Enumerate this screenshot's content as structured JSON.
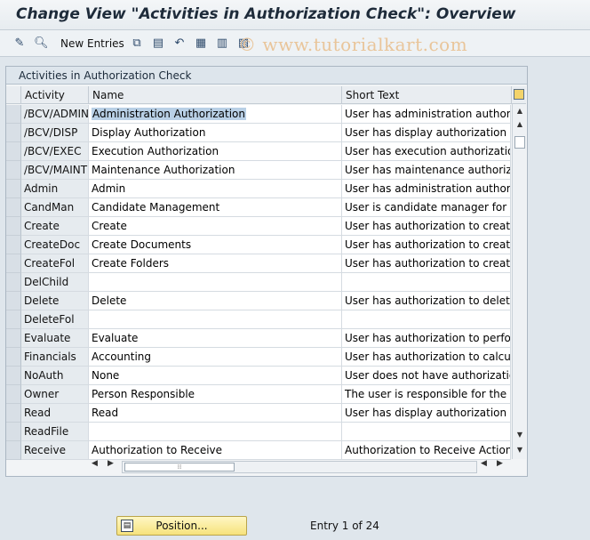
{
  "window": {
    "title": "Change View \"Activities in Authorization Check\": Overview"
  },
  "toolbar": {
    "new_entries_label": "New Entries",
    "watermark": "© www.tutorialkart.com",
    "icons": [
      "edit-toggle-icon",
      "details-icon",
      "copy-as-icon",
      "delete-icon",
      "undo-change-icon",
      "select-all-icon",
      "select-block-icon",
      "deselect-all-icon"
    ]
  },
  "panel": {
    "title": "Activities in Authorization Check",
    "columns": [
      "Activity",
      "Name",
      "Short Text"
    ],
    "rows": [
      {
        "activity": "/BCV/ADMIN",
        "name": "Administration Authorization",
        "short_text": "User has administration authorizatio"
      },
      {
        "activity": "/BCV/DISP",
        "name": "Display Authorization",
        "short_text": "User has display authorization for t"
      },
      {
        "activity": "/BCV/EXEC",
        "name": "Execution Authorization",
        "short_text": "User has execution authorization fo"
      },
      {
        "activity": "/BCV/MAINT",
        "name": "Maintenance Authorization",
        "short_text": "User has maintenance authorizatio"
      },
      {
        "activity": "Admin",
        "name": "Admin",
        "short_text": "User has administration authorizatio"
      },
      {
        "activity": "CandMan",
        "name": "Candidate Management",
        "short_text": "User is candidate manager for roles"
      },
      {
        "activity": "Create",
        "name": "Create",
        "short_text": "User has authorization to create an"
      },
      {
        "activity": "CreateDoc",
        "name": "Create Documents",
        "short_text": "User has authorization to create do"
      },
      {
        "activity": "CreateFol",
        "name": "Create Folders",
        "short_text": "User has authorization to create fo"
      },
      {
        "activity": "DelChild",
        "name": "",
        "short_text": ""
      },
      {
        "activity": "Delete",
        "name": "Delete",
        "short_text": "User has authorization to delete ol"
      },
      {
        "activity": "DeleteFol",
        "name": "",
        "short_text": ""
      },
      {
        "activity": "Evaluate",
        "name": "Evaluate",
        "short_text": "User has authorization to perform"
      },
      {
        "activity": "Financials",
        "name": "Accounting",
        "short_text": "User has authorization to calculate"
      },
      {
        "activity": "NoAuth",
        "name": "None",
        "short_text": "User does not have authorization"
      },
      {
        "activity": "Owner",
        "name": "Person Responsible",
        "short_text": "The user is responsible for the obj"
      },
      {
        "activity": "Read",
        "name": "Read",
        "short_text": "User has display authorization"
      },
      {
        "activity": "ReadFile",
        "name": "",
        "short_text": ""
      },
      {
        "activity": "Receive",
        "name": "Authorization to Receive",
        "short_text": "Authorization to Receive Action Mo"
      }
    ]
  },
  "footer": {
    "position_button": "Position...",
    "entry_info": "Entry 1 of 24"
  }
}
